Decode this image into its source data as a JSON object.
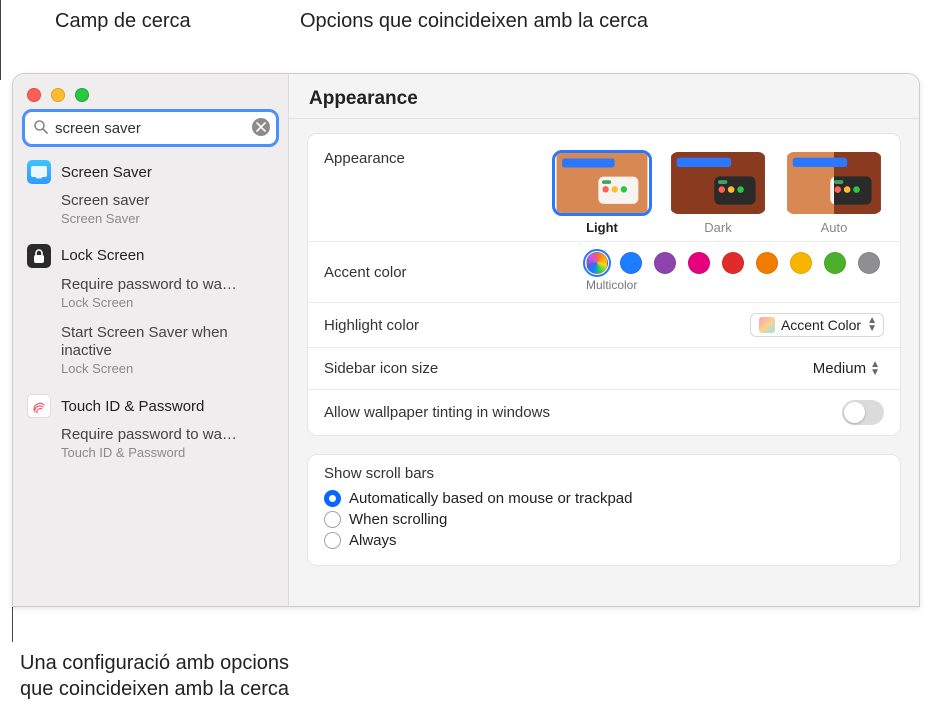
{
  "callouts": {
    "search_field": "Camp de cerca",
    "matching_options": "Opcions que coincideixen amb la cerca",
    "setting_with_matches_l1": "Una configuració amb opcions",
    "setting_with_matches_l2": "que coincideixen amb la cerca"
  },
  "search": {
    "value": "screen saver"
  },
  "sidebar": {
    "groups": [
      {
        "icon": "screensaver",
        "title": "Screen Saver",
        "subs": [
          {
            "name": "Screen saver",
            "cat": "Screen Saver"
          }
        ]
      },
      {
        "icon": "lock",
        "title": "Lock Screen",
        "subs": [
          {
            "name": "Require password to wa…",
            "cat": "Lock Screen"
          },
          {
            "name": "Start Screen Saver when inactive",
            "cat": "Lock Screen"
          }
        ]
      },
      {
        "icon": "touchid",
        "title": "Touch ID & Password",
        "subs": [
          {
            "name": "Require password to wa…",
            "cat": "Touch ID & Password"
          }
        ]
      }
    ]
  },
  "main": {
    "title": "Appearance",
    "appearance": {
      "label": "Appearance",
      "modes": [
        {
          "key": "light",
          "label": "Light",
          "selected": true
        },
        {
          "key": "dark",
          "label": "Dark",
          "selected": false
        },
        {
          "key": "auto",
          "label": "Auto",
          "selected": false
        }
      ]
    },
    "accent": {
      "label": "Accent color",
      "selected_label": "Multicolor",
      "colors": [
        "multi",
        "#1e7cff",
        "#8e44ad",
        "#e6007e",
        "#e02b2b",
        "#f07c00",
        "#f7b500",
        "#4cb12a",
        "#8e8e93"
      ]
    },
    "highlight": {
      "label": "Highlight color",
      "value": "Accent Color"
    },
    "sidebar_icon": {
      "label": "Sidebar icon size",
      "value": "Medium"
    },
    "allow_tint": {
      "label": "Allow wallpaper tinting in windows",
      "on": false
    },
    "scroll": {
      "label": "Show scroll bars",
      "options": [
        {
          "label": "Automatically based on mouse or trackpad",
          "checked": true
        },
        {
          "label": "When scrolling",
          "checked": false
        },
        {
          "label": "Always",
          "checked": false
        }
      ]
    }
  }
}
